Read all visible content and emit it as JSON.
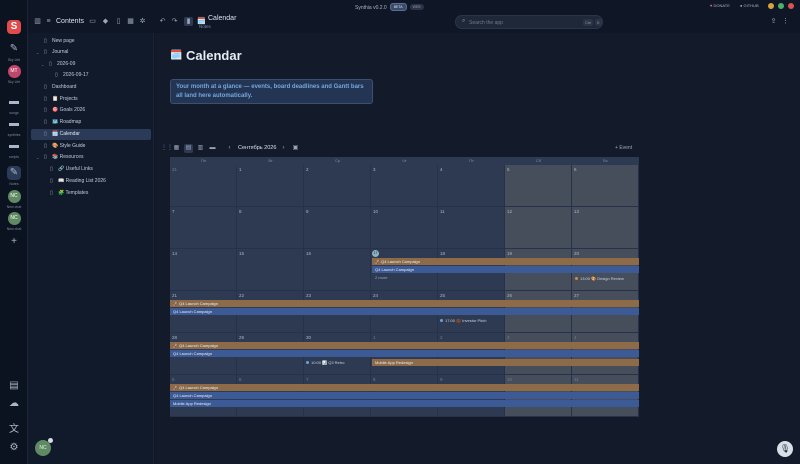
{
  "app": {
    "name": "Synthia v0.2.0",
    "badge_beta": "BETA",
    "badge_web": "WEB",
    "donate": "DONATE",
    "github": "GITHUB",
    "colors": {
      "accent": "#3c5a95",
      "event_orange": "#8d6b48",
      "logo": "#e24b4b"
    }
  },
  "rail": {
    "items": [
      {
        "label": "Synthia",
        "icon": "logo-icon"
      },
      {
        "label": "Sky Life",
        "icon": "pencil-icon"
      },
      {
        "label": "Sky Life",
        "avatar": "MT"
      },
      {
        "label": "songs",
        "icon": "folder-icon"
      },
      {
        "label": "synthies",
        "icon": "folder-icon"
      },
      {
        "label": "scripts",
        "icon": "folder-icon"
      },
      {
        "label": "Notes",
        "icon": "pencil-icon"
      },
      {
        "label": "New chat",
        "avatar": "NC"
      },
      {
        "label": "New chat",
        "avatar": "NC"
      }
    ]
  },
  "topbar": {
    "contents": "Contents",
    "doc_title": "Calendar",
    "doc_subtitle": "Notes",
    "search_placeholder": "Search the app",
    "kbd_ctrl": "Ctrl",
    "kbd_k": "K"
  },
  "sidebar": {
    "items": [
      {
        "label": "New page",
        "depth": 0
      },
      {
        "label": "Journal",
        "depth": 0,
        "expanded": true
      },
      {
        "label": "2026-09",
        "depth": 1,
        "expanded": true
      },
      {
        "label": "2026-09-17",
        "depth": 2
      },
      {
        "label": "Dashboard",
        "depth": 0
      },
      {
        "label": "📋 Projects",
        "depth": 0
      },
      {
        "label": "🎯 Goals 2026",
        "depth": 0
      },
      {
        "label": "🗺️ Roadmap",
        "depth": 0
      },
      {
        "label": "🗓️ Calendar",
        "depth": 0,
        "active": true
      },
      {
        "label": "🎨 Style Guide",
        "depth": 0
      },
      {
        "label": "📚 Resources",
        "depth": 0,
        "expanded": true
      },
      {
        "label": "🔗 Useful Links",
        "depth": 1
      },
      {
        "label": "📖 Reading List 2026",
        "depth": 1
      },
      {
        "label": "🧩 Templates",
        "depth": 1
      }
    ],
    "user_avatar": "NC"
  },
  "page": {
    "emoji": "🗓️",
    "title": "Calendar",
    "callout": "Your month at a glance — events, board deadlines and Gantt bars all land here automatically."
  },
  "calendar": {
    "month_label": "Сентябрь 2026",
    "event_button": "Event",
    "weekdays": [
      "Пн",
      "Вт",
      "Ср",
      "Чт",
      "Пт",
      "Сб",
      "Вс"
    ],
    "weeks": [
      [
        "31",
        "1",
        "2",
        "3",
        "4",
        "5",
        "6"
      ],
      [
        "7",
        "8",
        "9",
        "10",
        "11",
        "12",
        "13"
      ],
      [
        "14",
        "15",
        "16",
        "17",
        "18",
        "19",
        "20"
      ],
      [
        "21",
        "22",
        "23",
        "24",
        "25",
        "26",
        "27"
      ],
      [
        "28",
        "29",
        "30",
        "1",
        "2",
        "3",
        "4"
      ],
      [
        "5",
        "6",
        "7",
        "8",
        "9",
        "10",
        "11"
      ]
    ],
    "events": {
      "w2_launch": "🚀 Q4 Launch Campaign",
      "w2_campaign": "Q4 Launch Campaign",
      "w2_more": "2 more",
      "w2_design": "13:00 🎨 Design Review",
      "w3_launch": "🚀 Q4 Launch Campaign",
      "w3_campaign": "Q4 Launch Campaign",
      "w3_pitch": "17:00 💼 Investor Pitch",
      "w4_launch": "🚀 Q4 Launch Campaign",
      "w4_campaign": "Q4 Launch Campaign",
      "w4_retro": "10:00 📊 Q3 Retro",
      "w4_redesign": "Mobile App Redesign",
      "w5_launch": "🚀 Q4 Launch Campaign",
      "w5_campaign": "Q4 Launch Campaign",
      "w5_redesign": "Mobile App Redesign"
    }
  }
}
